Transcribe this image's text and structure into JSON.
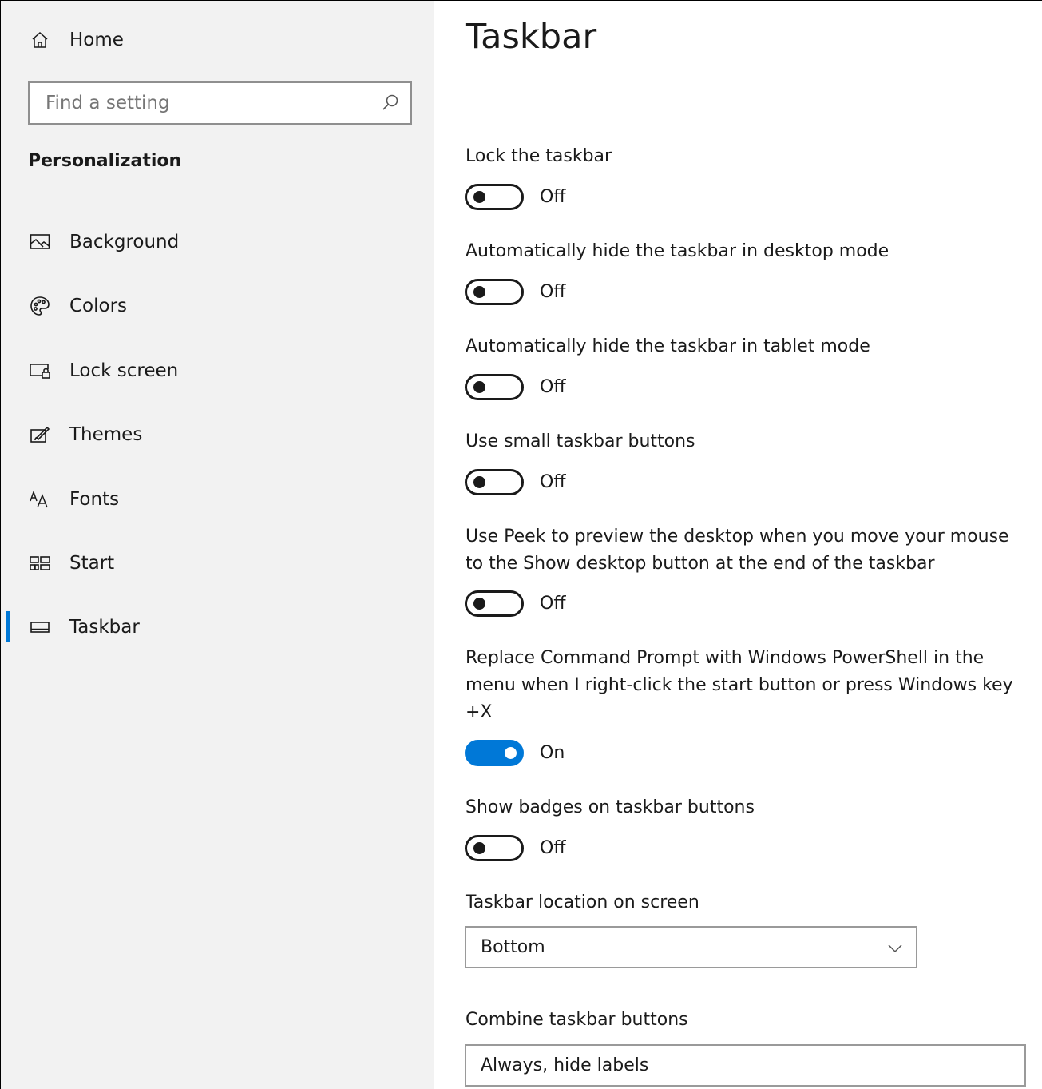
{
  "sidebar": {
    "home_label": "Home",
    "search_placeholder": "Find a setting",
    "section_heading": "Personalization",
    "items": [
      {
        "label": "Background",
        "icon": "image-icon"
      },
      {
        "label": "Colors",
        "icon": "palette-icon"
      },
      {
        "label": "Lock screen",
        "icon": "lock-screen-icon"
      },
      {
        "label": "Themes",
        "icon": "brush-icon"
      },
      {
        "label": "Fonts",
        "icon": "fonts-icon"
      },
      {
        "label": "Start",
        "icon": "start-tiles-icon"
      },
      {
        "label": "Taskbar",
        "icon": "taskbar-icon",
        "active": true
      }
    ]
  },
  "main": {
    "title": "Taskbar",
    "settings": [
      {
        "label": "Lock the taskbar",
        "state": "Off",
        "on": false
      },
      {
        "label": "Automatically hide the taskbar in desktop mode",
        "state": "Off",
        "on": false
      },
      {
        "label": "Automatically hide the taskbar in tablet mode",
        "state": "Off",
        "on": false
      },
      {
        "label": "Use small taskbar buttons",
        "state": "Off",
        "on": false
      },
      {
        "label_line1": "Use Peek to preview the desktop when you move your mouse",
        "label_line2": "to the Show desktop button at the end of the taskbar",
        "state": "Off",
        "on": false
      },
      {
        "label_line1": "Replace Command Prompt with Windows PowerShell in the",
        "label_line2": "menu when I right-click the start button or press Windows key",
        "label_line3": "+X",
        "state": "On",
        "on": true
      },
      {
        "label": "Show badges on taskbar buttons",
        "state": "Off",
        "on": false
      }
    ],
    "location": {
      "label": "Taskbar location on screen",
      "value": "Bottom"
    },
    "combine": {
      "label": "Combine taskbar buttons",
      "value": "Always, hide labels"
    }
  },
  "colors": {
    "accent": "#0078d7",
    "sidebar_bg": "#f2f2f2"
  }
}
